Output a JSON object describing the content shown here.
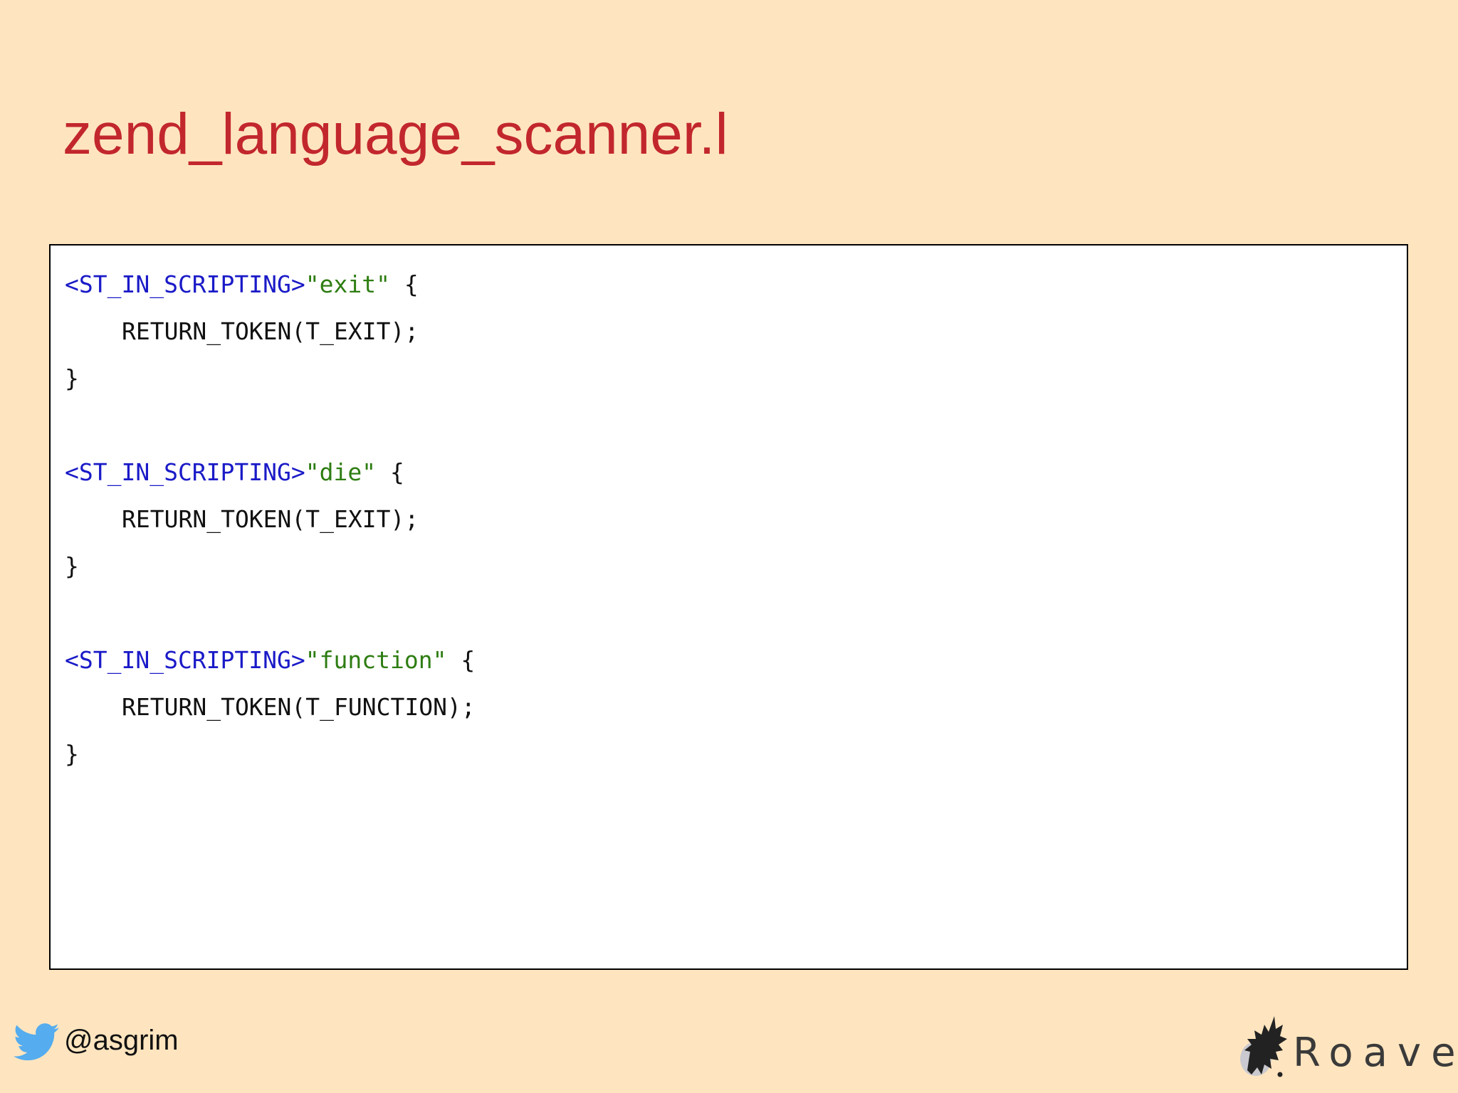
{
  "slide": {
    "title": "zend_language_scanner.l"
  },
  "code": {
    "blocks": [
      {
        "state": "<ST_IN_SCRIPTING>",
        "string": "\"exit\"",
        "open": " {",
        "body": "RETURN_TOKEN(T_EXIT);",
        "close": "}"
      },
      {
        "state": "<ST_IN_SCRIPTING>",
        "string": "\"die\"",
        "open": " {",
        "body": "RETURN_TOKEN(T_EXIT);",
        "close": "}"
      },
      {
        "state": "<ST_IN_SCRIPTING>",
        "string": "\"function\"",
        "open": " {",
        "body": "RETURN_TOKEN(T_FUNCTION);",
        "close": "}"
      }
    ],
    "colors": {
      "state": "#1a1ac8",
      "string": "#2e7d12",
      "plain": "#111111"
    }
  },
  "footer": {
    "twitter_handle": "@asgrim",
    "twitter_icon": "twitter-bird-icon",
    "logo_text": "Roave",
    "logo_icon": "roave-hedgehog-icon"
  },
  "colors": {
    "background": "#ffe5bf",
    "title": "#c2272d",
    "twitter_blue": "#55acee"
  }
}
